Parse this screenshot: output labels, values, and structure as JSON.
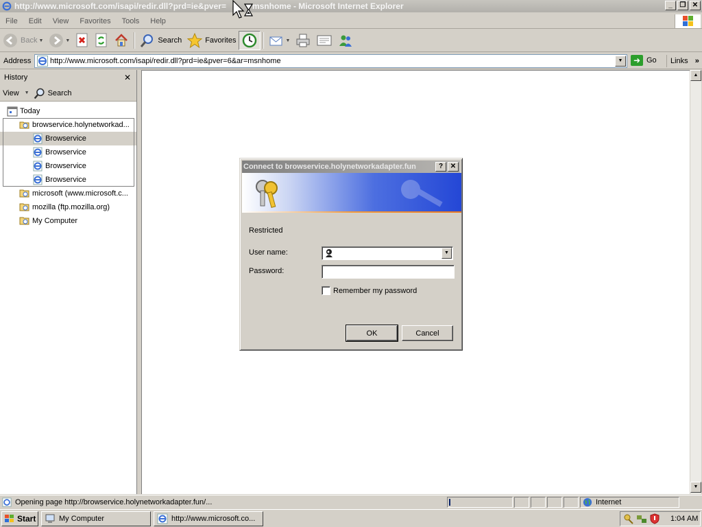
{
  "window": {
    "title_left": "http://www.microsoft.com/isapi/redir.dll?prd=ie&pver=",
    "title_right": "msnhome - Microsoft Internet Explorer",
    "buttons": [
      "_",
      "❐",
      "✕"
    ]
  },
  "menu": [
    "File",
    "Edit",
    "View",
    "Favorites",
    "Tools",
    "Help"
  ],
  "toolbar": {
    "back_label": "Back",
    "search_label": "Search",
    "favorites_label": "Favorites"
  },
  "address": {
    "label": "Address",
    "url": "http://www.microsoft.com/isapi/redir.dll?prd=ie&pver=6&ar=msnhome",
    "go_label": "Go",
    "links_label": "Links",
    "links_chevron": "»"
  },
  "sidebar": {
    "title": "History",
    "close": "✕",
    "view_label": "View",
    "search_label": "Search",
    "today_label": "Today",
    "sites": [
      {
        "label": "browservice.holynetworkad...",
        "pages": [
          "Browservice",
          "Browservice",
          "Browservice",
          "Browservice"
        ]
      },
      {
        "label": "microsoft (www.microsoft.c..."
      },
      {
        "label": "mozilla (ftp.mozilla.org)"
      },
      {
        "label": "My Computer"
      }
    ]
  },
  "dialog": {
    "title": "Connect to browservice.holynetworkadapter.fun",
    "help_btn": "?",
    "close_btn": "✕",
    "realm": "Restricted",
    "username_label": "User name:",
    "username_value": "",
    "password_label": "Password:",
    "remember_label": "Remember my password",
    "remember_checked": false,
    "ok_label": "OK",
    "cancel_label": "Cancel"
  },
  "status": {
    "text": "Opening page http://browservice.holynetworkadapter.fun/...",
    "zone": "Internet"
  },
  "taskbar": {
    "start_label": "Start",
    "tasks": [
      "My Computer",
      "http://www.microsoft.co..."
    ],
    "clock": "1:04 AM"
  },
  "colors": {
    "banner_blue": "#2447d6",
    "banner_orange": "#e87722",
    "go_green": "#2c9e2c"
  }
}
